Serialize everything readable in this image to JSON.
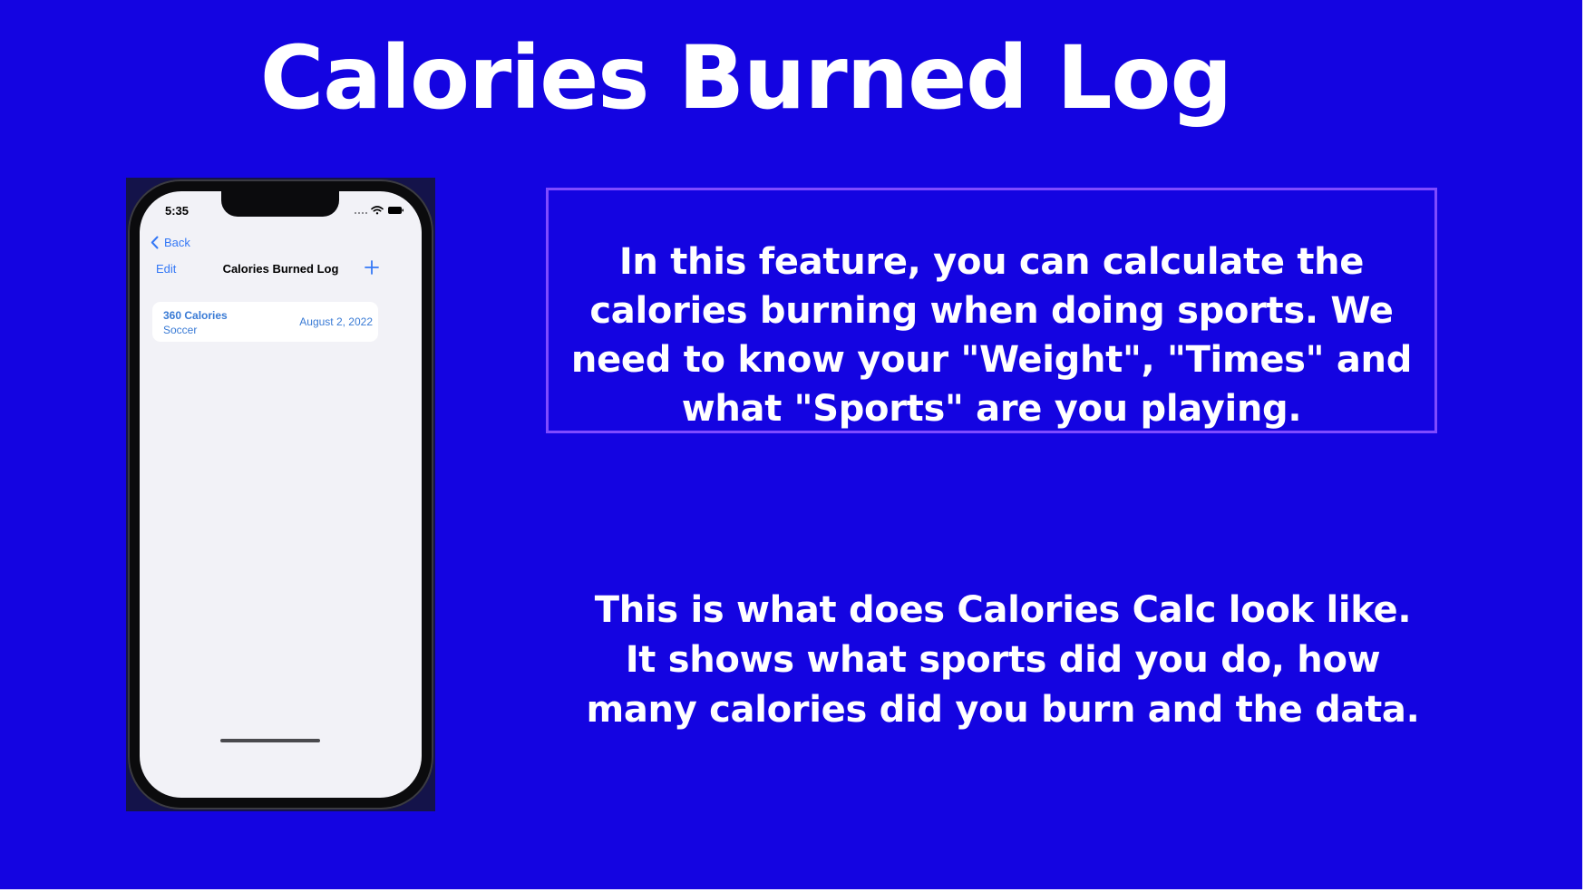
{
  "slide": {
    "title": "Calories Burned Log",
    "background_color": "#1404e1",
    "box_border_color": "#7f4bff",
    "feature_lines": [
      "In this feature, you can calculate the",
      "calories burning when doing sports. We",
      "need to know your \"Weight\", \"Times\" and",
      "what \"Sports\" are you playing."
    ],
    "description_lines": [
      "This is what does Calories Calc look like.",
      "It shows what sports did you do, how",
      "many calories did you burn and the data."
    ]
  },
  "phone": {
    "status_bar": {
      "time": "5:35",
      "icons": [
        "signal-icon",
        "wifi-icon",
        "battery-icon"
      ]
    },
    "back_label": "Back",
    "nav": {
      "edit_label": "Edit",
      "title": "Calories Burned Log",
      "add_icon": "plus-icon"
    },
    "entries": [
      {
        "calories": "360 Calories",
        "sport": "Soccer",
        "date": "August 2, 2022"
      }
    ],
    "accent_color": "#3478f6"
  }
}
